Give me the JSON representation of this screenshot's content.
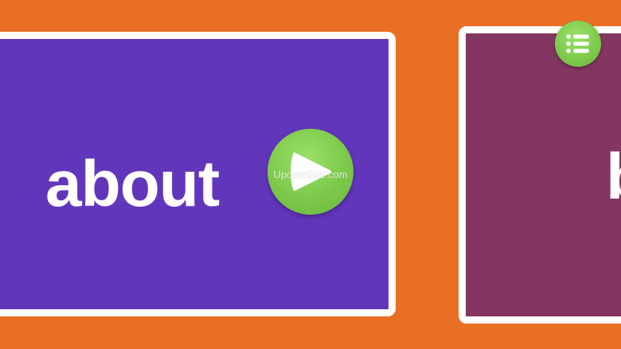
{
  "cards": [
    {
      "title": "about",
      "color": "#6236bb"
    },
    {
      "title": "b",
      "color": "#843662"
    }
  ],
  "watermark": "UpdateStar.com",
  "icons": {
    "play": "play-icon",
    "menu": "list-icon"
  },
  "colors": {
    "background": "#e96f24",
    "badge_green": "#7cc94a",
    "card_border": "#ffffff"
  }
}
